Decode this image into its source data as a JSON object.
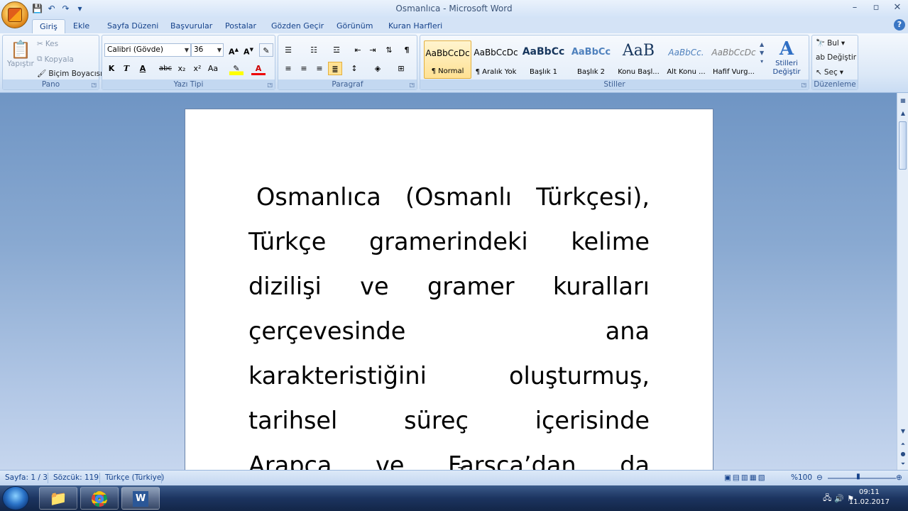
{
  "window": {
    "title": "Osmanlıca - Microsoft Word"
  },
  "tabs": [
    "Giriş",
    "Ekle",
    "Sayfa Düzeni",
    "Başvurular",
    "Postalar",
    "Gözden Geçir",
    "Görünüm",
    "Kuran Harfleri"
  ],
  "ribbon": {
    "pano": {
      "label": "Pano",
      "paste": "Yapıştır",
      "cut": "Kes",
      "copy": "Kopyala",
      "format_painter": "Biçim Boyacısı"
    },
    "font": {
      "label": "Yazı Tipi",
      "family": "Calibri (Gövde)",
      "size": "36",
      "bold": "K",
      "italic": "T",
      "strike": "abc",
      "sub": "x₂",
      "sup": "x²",
      "case": "Aa"
    },
    "paragraph": {
      "label": "Paragraf"
    },
    "styles": {
      "label": "Stiller",
      "change_styles": "Stilleri Değiştir",
      "items": [
        {
          "sample": "AaBbCcDc",
          "name": "¶ Normal"
        },
        {
          "sample": "AaBbCcDc",
          "name": "¶ Aralık Yok"
        },
        {
          "sample": "AaBbCc",
          "name": "Başlık 1"
        },
        {
          "sample": "AaBbCc",
          "name": "Başlık 2"
        },
        {
          "sample": "AaB",
          "name": "Konu Başl..."
        },
        {
          "sample": "AaBbCc.",
          "name": "Alt Konu ..."
        },
        {
          "sample": "AaBbCcDc",
          "name": "Hafif Vurg..."
        }
      ]
    },
    "editing": {
      "label": "Düzenleme",
      "find": "Bul",
      "replace": "Değiştir",
      "select": "Seç"
    }
  },
  "document": {
    "lines": [
      [
        "Osmanlıca",
        "(Osmanlı",
        "Türkçesi),"
      ],
      [
        "Türkçe",
        "gramerindeki",
        "kelime"
      ],
      [
        "dizilişi",
        "ve",
        "gramer",
        "kuralları"
      ],
      [
        "çerçevesinde",
        "ana"
      ],
      [
        "karakteristiğini",
        "oluşturmuş,"
      ],
      [
        "tarihsel",
        "süreç",
        "içerisinde"
      ],
      [
        "Arapça",
        "ve",
        "Farsça’dan",
        "da"
      ]
    ]
  },
  "status": {
    "page": "Sayfa: 1 / 3",
    "words": "Sözcük: 119",
    "language": "Türkçe (Türkiye)",
    "zoom": "%100"
  },
  "clock": {
    "time": "09:11",
    "date": "11.02.2017"
  }
}
